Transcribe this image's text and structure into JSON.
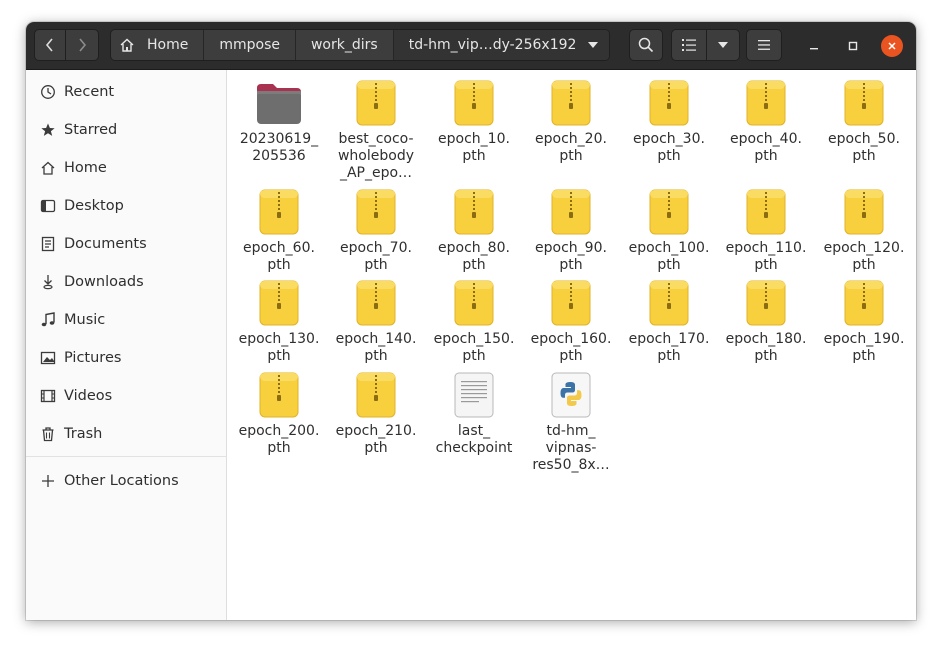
{
  "breadcrumbs": [
    "Home",
    "mmpose",
    "work_dirs",
    "td-hm_vip…dy-256x192"
  ],
  "sidebar": {
    "items": [
      {
        "label": "Recent",
        "icon": "clock-icon"
      },
      {
        "label": "Starred",
        "icon": "star-icon"
      },
      {
        "label": "Home",
        "icon": "home-icon"
      },
      {
        "label": "Desktop",
        "icon": "desktop-icon"
      },
      {
        "label": "Documents",
        "icon": "document-icon"
      },
      {
        "label": "Downloads",
        "icon": "download-icon"
      },
      {
        "label": "Music",
        "icon": "music-icon"
      },
      {
        "label": "Pictures",
        "icon": "picture-icon"
      },
      {
        "label": "Videos",
        "icon": "video-icon"
      },
      {
        "label": "Trash",
        "icon": "trash-icon"
      }
    ],
    "other_locations": "Other Locations"
  },
  "files": [
    {
      "name": "20230619_\n205536",
      "type": "folder"
    },
    {
      "name": "best_coco-\nwholebody\n_AP_epo…",
      "type": "archive"
    },
    {
      "name": "epoch_10.\npth",
      "type": "archive"
    },
    {
      "name": "epoch_20.\npth",
      "type": "archive"
    },
    {
      "name": "epoch_30.\npth",
      "type": "archive"
    },
    {
      "name": "epoch_40.\npth",
      "type": "archive"
    },
    {
      "name": "epoch_50.\npth",
      "type": "archive"
    },
    {
      "name": "epoch_60.\npth",
      "type": "archive"
    },
    {
      "name": "epoch_70.\npth",
      "type": "archive"
    },
    {
      "name": "epoch_80.\npth",
      "type": "archive"
    },
    {
      "name": "epoch_90.\npth",
      "type": "archive"
    },
    {
      "name": "epoch_100.\npth",
      "type": "archive"
    },
    {
      "name": "epoch_110.\npth",
      "type": "archive"
    },
    {
      "name": "epoch_120.\npth",
      "type": "archive"
    },
    {
      "name": "epoch_130.\npth",
      "type": "archive"
    },
    {
      "name": "epoch_140.\npth",
      "type": "archive"
    },
    {
      "name": "epoch_150.\npth",
      "type": "archive"
    },
    {
      "name": "epoch_160.\npth",
      "type": "archive"
    },
    {
      "name": "epoch_170.\npth",
      "type": "archive"
    },
    {
      "name": "epoch_180.\npth",
      "type": "archive"
    },
    {
      "name": "epoch_190.\npth",
      "type": "archive"
    },
    {
      "name": "epoch_200.\npth",
      "type": "archive"
    },
    {
      "name": "epoch_210.\npth",
      "type": "archive"
    },
    {
      "name": "last_\ncheckpoint",
      "type": "text"
    },
    {
      "name": "td-hm_\nvipnas-\nres50_8x…",
      "type": "python"
    }
  ],
  "colors": {
    "headerbar": "#2c2c2c",
    "close_button": "#e95420",
    "archive_yellow": "#f8cf3c",
    "folder_gray": "#6e6e6e",
    "folder_tab": "#a83250"
  }
}
